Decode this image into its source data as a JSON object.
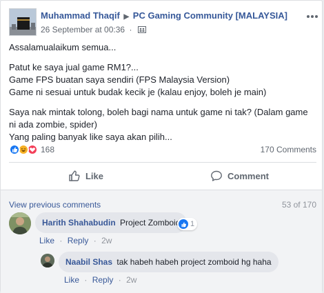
{
  "post": {
    "author": "Muhammad Thaqif",
    "group": "PC Gaming Community [MALAYSIA]",
    "timestamp": "26 September at 00:36",
    "paragraphs": [
      "Assalamualaikum semua...",
      "Patut ke saya jual game RM1?...\nGame FPS buatan saya sendiri (FPS Malaysia Version)\nGame ni sesuai untuk budak kecik je (kalau enjoy, boleh je main)",
      "Saya nak mintak tolong, boleh bagi nama untuk game ni tak? (Dalam game ni ada zombie, spider)\nYang paling banyak like saya akan pilih..."
    ],
    "reaction_count": "168",
    "comment_count": "170 Comments",
    "reaction_icons": [
      "like-reaction-icon",
      "haha-reaction-icon",
      "love-reaction-icon"
    ]
  },
  "actions": {
    "like_label": "Like",
    "comment_label": "Comment"
  },
  "comments_section": {
    "view_previous": "View previous comments",
    "page_count": "53 of 170",
    "comments": [
      {
        "author": "Harith Shahabudin",
        "text": "Project Zomboid",
        "like_count": "1",
        "like_label": "Like",
        "reply_label": "Reply",
        "time": "2w"
      },
      {
        "author": "Naabil Shas",
        "text": "tak habeh habeh project zomboid hg haha",
        "like_label": "Like",
        "reply_label": "Reply",
        "time": "2w"
      }
    ]
  },
  "colors": {
    "link": "#365899",
    "like_blue": "#1877f2",
    "love_red": "#f33e58",
    "haha_yellow": "#f7b125",
    "muted": "#606770"
  }
}
